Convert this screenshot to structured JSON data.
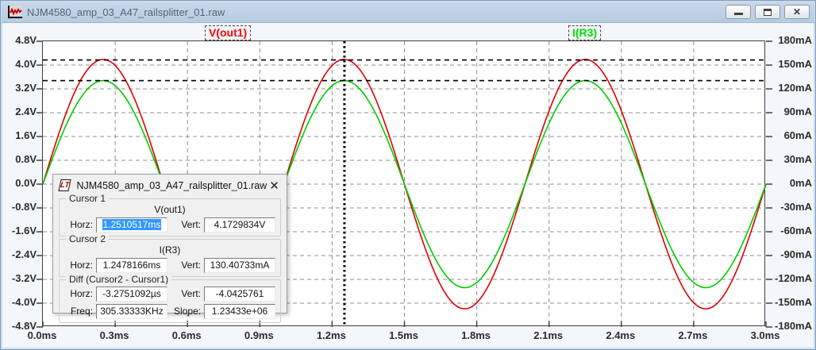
{
  "window": {
    "title": "NJM4580_amp_03_A47_railsplitter_01.raw",
    "controls": {
      "minimize": "minimize",
      "restore": "restore",
      "close": "close"
    }
  },
  "traces": [
    {
      "label": "V(out1)",
      "color": "#dd0000"
    },
    {
      "label": "I(R3)",
      "color": "#00cc00"
    }
  ],
  "chart_data": {
    "type": "line",
    "title": "",
    "xlabel": "time",
    "x_range_ms": [
      0,
      3
    ],
    "x_ticks": {
      "values": [
        0,
        0.3,
        0.6,
        0.9,
        1.2,
        1.5,
        1.8,
        2.1,
        2.4,
        2.7,
        3.0
      ],
      "labels": [
        "0.0ms",
        "0.3ms",
        "0.6ms",
        "0.9ms",
        "1.2ms",
        "1.5ms",
        "1.8ms",
        "2.1ms",
        "2.4ms",
        "2.7ms",
        "3.0ms"
      ]
    },
    "left_axis": {
      "unit": "V",
      "range": [
        -4.8,
        4.8
      ],
      "ticks": {
        "values": [
          4.8,
          4.0,
          3.2,
          2.4,
          1.6,
          0.8,
          0.0,
          -0.8,
          -1.6,
          -2.4,
          -3.2,
          -4.0,
          -4.8
        ],
        "labels": [
          "4.8V",
          "4.0V",
          "3.2V",
          "2.4V",
          "1.6V",
          "0.8V",
          "0.0V",
          "-0.8V",
          "-1.6V",
          "-2.4V",
          "-3.2V",
          "-4.0V",
          "-4.8V"
        ]
      }
    },
    "right_axis": {
      "unit": "mA",
      "range": [
        -180,
        180
      ],
      "ticks": {
        "values": [
          180,
          150,
          120,
          90,
          60,
          30,
          0,
          -30,
          -60,
          -90,
          -120,
          -150,
          -180
        ],
        "labels": [
          "180mA",
          "150mA",
          "120mA",
          "90mA",
          "60mA",
          "30mA",
          "0mA",
          "-30mA",
          "-60mA",
          "-90mA",
          "-120mA",
          "-150mA",
          "-180mA"
        ]
      }
    },
    "grid": true,
    "series": [
      {
        "name": "V(out1)",
        "color": "#dd0000",
        "axis": "left",
        "waveform": "sine",
        "amplitude": 4.19,
        "frequency_khz": 1,
        "phase_deg": 0
      },
      {
        "name": "I(R3)",
        "color": "#00cc00",
        "axis": "right",
        "waveform": "sine",
        "amplitude": 130.41,
        "frequency_khz": 1,
        "phase_deg": 0
      }
    ],
    "cursors": {
      "cursor1": {
        "t_ms": 1.2510517,
        "value": 4.1729834,
        "axis": "left"
      },
      "cursor2": {
        "t_ms": 1.2478166,
        "value": 130.40733,
        "axis": "right"
      }
    }
  },
  "cursor_dialog": {
    "title": "NJM4580_amp_03_A47_railsplitter_01.raw",
    "close_label": "✕",
    "cursor1": {
      "legend": "Cursor 1",
      "trace": "V(out1)",
      "horz_label": "Horz:",
      "horz_value": "1.2510517ms",
      "vert_label": "Vert:",
      "vert_value": "4.1729834V"
    },
    "cursor2": {
      "legend": "Cursor 2",
      "trace": "I(R3)",
      "horz_label": "Horz:",
      "horz_value": "1.2478166ms",
      "vert_label": "Vert:",
      "vert_value": "130.40733mA"
    },
    "diff": {
      "legend": "Diff (Cursor2 - Cursor1)",
      "horz_label": "Horz:",
      "horz_value": "-3.2751092µs",
      "vert_label": "Vert:",
      "vert_value": "-4.0425761",
      "freq_label": "Freq:",
      "freq_value": "305.33333KHz",
      "slope_label": "Slope:",
      "slope_value": "1.23433e+06"
    }
  }
}
